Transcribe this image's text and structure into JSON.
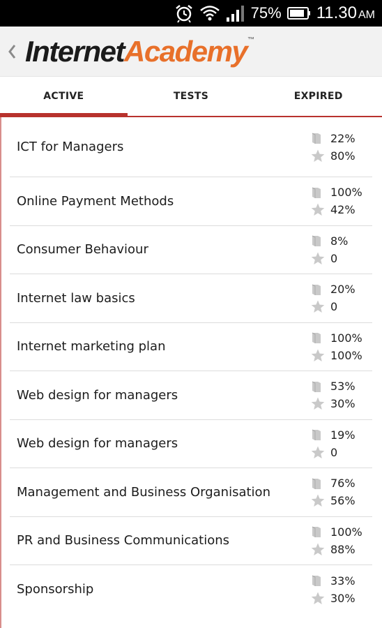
{
  "status_bar": {
    "battery_percent": "75%",
    "time": "11.30",
    "ampm": "AM"
  },
  "app": {
    "logo_part1": "Internet",
    "logo_part2": "Academy",
    "logo_tm": "™",
    "colors": {
      "brand_orange": "#e8702a",
      "accent_red": "#b8322d"
    }
  },
  "tabs": [
    {
      "label": "ACTIVE",
      "selected": true
    },
    {
      "label": "TESTS",
      "selected": false
    },
    {
      "label": "EXPIRED",
      "selected": false
    }
  ],
  "courses": [
    {
      "title": "ICT for Managers",
      "progress": "22%",
      "score": "80%"
    },
    {
      "title": "Online Payment Methods",
      "progress": "100%",
      "score": "42%"
    },
    {
      "title": "Consumer Behaviour",
      "progress": "8%",
      "score": "0"
    },
    {
      "title": "Internet law basics",
      "progress": "20%",
      "score": "0"
    },
    {
      "title": "Internet marketing plan",
      "progress": "100%",
      "score": "100%"
    },
    {
      "title": "Web design for managers",
      "progress": "53%",
      "score": "30%"
    },
    {
      "title": "Web design for managers",
      "progress": "19%",
      "score": "0"
    },
    {
      "title": "Management and Business Organisation",
      "progress": "76%",
      "score": "56%"
    },
    {
      "title": "PR and Business Communications",
      "progress": "100%",
      "score": "88%"
    },
    {
      "title": "Sponsorship",
      "progress": "33%",
      "score": "30%"
    }
  ],
  "icons": {
    "progress": "book-icon",
    "score": "star-icon"
  }
}
